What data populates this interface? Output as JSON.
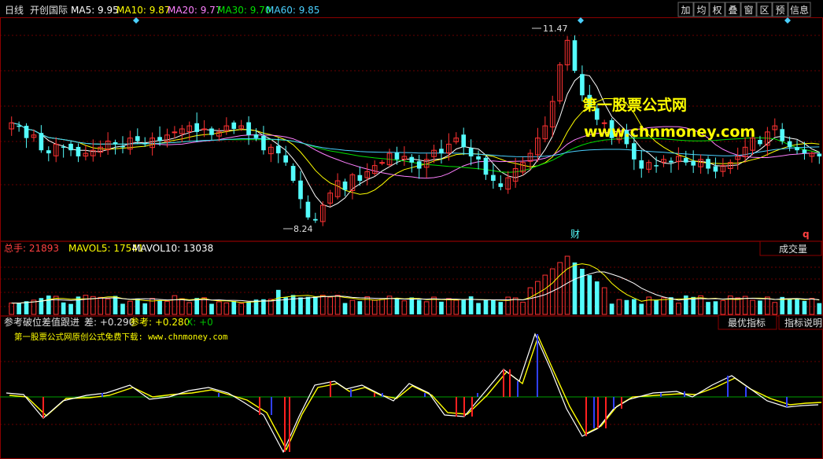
{
  "colors": {
    "bg": "#000000",
    "grid": "#8b0000",
    "up": "#ff3232",
    "down": "#54fcfc",
    "ma5": "#ffffff",
    "ma10": "#ffff00",
    "ma20": "#ff80ff",
    "ma30": "#00e000",
    "ma60": "#4ad0ff",
    "brand": "#ffff00",
    "signal_red": "#ff2020",
    "signal_blue": "#3040ff",
    "toolbar_text": "#e0e0e0"
  },
  "header": {
    "period": "日线",
    "stock_name": "开创国际",
    "ma5": "MA5: 9.95",
    "ma10": "MA10: 9.87",
    "ma20": "MA20: 9.77",
    "ma30": "MA30: 9.70",
    "ma60": "MA60: 9.85"
  },
  "toolbar": {
    "buttons": [
      "加",
      "均",
      "权",
      "叠",
      "窗",
      "区",
      "预",
      "信息"
    ],
    "volume_btn": "成交量",
    "best_btn": "最优指标",
    "explain_btn": "指标说明"
  },
  "watermark": {
    "line1": "第一股票公式网",
    "line2": "www.chnmoney.com"
  },
  "price_annotations": {
    "high": "11.47",
    "low": "8.24",
    "fin_mark": "财",
    "q_mark": "q"
  },
  "volume_header": {
    "total": "总手: 21893",
    "mavol5": "MAVOL5: 17541",
    "mavol10": "MAVOL10: 13038"
  },
  "indicator_header": {
    "name": "参考破位差值跟进",
    "diff": "差: +0.290",
    "ref": "参考: +0.280",
    "x": "X: +0"
  },
  "indicator_subtitle": "第一股票公式网原创公式免费下载: www.chnmoney.com",
  "chart_data": {
    "type": "candlestick",
    "candles_close": [
      9.95,
      9.9,
      9.7,
      9.75,
      9.5,
      9.45,
      9.6,
      9.55,
      9.5,
      9.4,
      9.45,
      9.5,
      9.55,
      9.65,
      9.6,
      9.55,
      9.7,
      9.65,
      9.6,
      9.7,
      9.65,
      9.75,
      9.8,
      9.85,
      9.9,
      9.8,
      9.85,
      9.75,
      9.8,
      9.9,
      9.85,
      9.9,
      9.75,
      9.7,
      9.5,
      9.55,
      9.45,
      9.3,
      9.0,
      8.7,
      8.4,
      8.35,
      8.6,
      8.8,
      9.0,
      8.85,
      9.1,
      9.0,
      9.15,
      9.25,
      9.3,
      9.45,
      9.35,
      9.4,
      9.3,
      9.2,
      9.35,
      9.5,
      9.45,
      9.6,
      9.7,
      9.55,
      9.4,
      9.35,
      9.1,
      9.0,
      8.9,
      9.05,
      9.2,
      9.3,
      9.45,
      9.7,
      9.9,
      10.3,
      10.9,
      11.3,
      10.8,
      10.4,
      10.2,
      10.0,
      9.95,
      9.7,
      9.8,
      9.6,
      9.35,
      9.2,
      9.3,
      9.25,
      9.35,
      9.3,
      9.4,
      9.3,
      9.25,
      9.35,
      9.2,
      9.15,
      9.25,
      9.3,
      9.4,
      9.55,
      9.7,
      9.6,
      9.8,
      9.9,
      9.65,
      9.55,
      9.5,
      9.45,
      9.45,
      9.4
    ],
    "price_high": 11.47,
    "price_low": 8.24,
    "volume_header_values": {
      "total": 21893,
      "mavol5": 17541,
      "mavol10": 13038
    },
    "indicator_values": {
      "diff": 0.29,
      "ref": 0.28,
      "x": 0
    }
  }
}
